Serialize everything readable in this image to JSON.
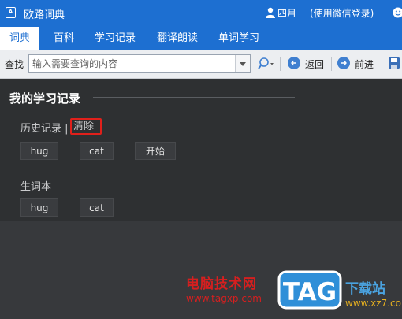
{
  "window": {
    "logo_text": "A",
    "title": "欧路词典",
    "user_name": "四月",
    "login_link": "(使用微信登录)"
  },
  "tabs": [
    {
      "label": "词典",
      "active": true
    },
    {
      "label": "百科",
      "active": false
    },
    {
      "label": "学习记录",
      "active": false
    },
    {
      "label": "翻译朗读",
      "active": false
    },
    {
      "label": "单词学习",
      "active": false
    }
  ],
  "toolbar": {
    "search_label": "查找",
    "search_placeholder": "输入需要查询的内容",
    "back_label": "返回",
    "forward_label": "前进"
  },
  "study": {
    "title": "我的学习记录",
    "history": {
      "label": "历史记录 |",
      "clear_label": "清除",
      "words": [
        "hug",
        "cat",
        "开始"
      ]
    },
    "vocab": {
      "label": "生词本",
      "words": [
        "hug",
        "cat"
      ]
    }
  },
  "watermark": {
    "brand": "电脑技术网",
    "url": "www.tagxp.com",
    "logo": "TAG",
    "site": "下载站",
    "domain": "www.xz7.com"
  },
  "colors": {
    "accent": "#1d6fd1",
    "highlight_border": "#e0201b",
    "content_bg": "#2e3032"
  }
}
